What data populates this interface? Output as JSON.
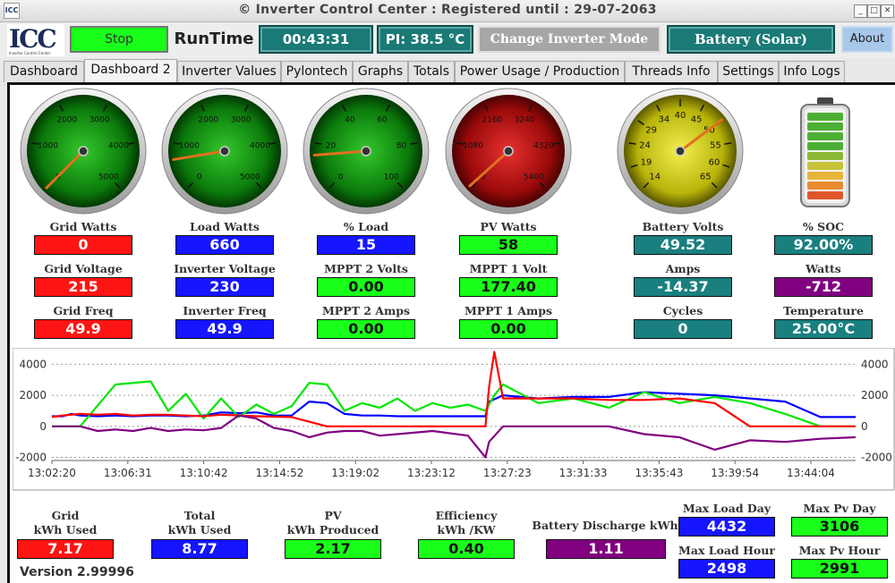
{
  "window": {
    "title": "© Inverter Control Center : Registered until : 29-07-2063",
    "app_icon": "ICC"
  },
  "toolbar": {
    "logo": "ICC",
    "logo_sub": "Inverter Control Center",
    "stop_label": "Stop",
    "runtime_label": "RunTime",
    "runtime_value": "00:43:31",
    "pi_temp": "PI: 38.5 °C",
    "change_mode_label": "Change Inverter Mode",
    "battery_mode": "Battery (Solar)",
    "about_label": "About"
  },
  "tabs": [
    "Dashboard",
    "Dashboard 2",
    "Inverter Values",
    "Pylontech",
    "Graphs",
    "Totals",
    "Power Usage / Production",
    "Threads Info",
    "Settings",
    "Info Logs"
  ],
  "active_tab": "Dashboard 2",
  "gauges": [
    {
      "name": "grid-watts-gauge",
      "ticks": [
        "0",
        "1000",
        "2000",
        "3000",
        "4000",
        "5000"
      ],
      "min": 0,
      "max": 5000,
      "value": 0
    },
    {
      "name": "load-watts-gauge",
      "ticks": [
        "0",
        "1000",
        "2000",
        "3000",
        "4000",
        "5000"
      ],
      "min": 0,
      "max": 5000,
      "value": 660
    },
    {
      "name": "percent-load-gauge",
      "ticks": [
        "0",
        "20",
        "40",
        "60",
        "80",
        "100"
      ],
      "min": 0,
      "max": 100,
      "value": 15
    },
    {
      "name": "pv-watts-gauge",
      "ticks": [
        "0",
        "1080",
        "2160",
        "3240",
        "4320",
        "5400"
      ],
      "min": 0,
      "max": 5400,
      "value": 58
    },
    {
      "name": "battery-volts-gauge",
      "ticks": [
        "14",
        "19",
        "24",
        "29",
        "34",
        "40",
        "45",
        "50",
        "55",
        "60",
        "65"
      ],
      "min": 14,
      "max": 65,
      "value": 49.52
    }
  ],
  "soc_colors": [
    "#4caf35",
    "#4caf35",
    "#4caf35",
    "#4caf35",
    "#8ab833",
    "#c8c33a",
    "#e8b43a",
    "#e88a2f",
    "#e0562a"
  ],
  "metrics": {
    "grid_watts": {
      "label": "Grid Watts",
      "value": "0"
    },
    "load_watts": {
      "label": "Load Watts",
      "value": "660"
    },
    "pct_load": {
      "label": "% Load",
      "value": "15"
    },
    "pv_watts": {
      "label": "PV Watts",
      "value": "58"
    },
    "battery_volts": {
      "label": "Battery Volts",
      "value": "49.52"
    },
    "soc": {
      "label": "% SOC",
      "value": "92.00%"
    },
    "grid_voltage": {
      "label": "Grid Voltage",
      "value": "215"
    },
    "inverter_voltage": {
      "label": "Inverter Voltage",
      "value": "230"
    },
    "mppt2_volts": {
      "label": "MPPT 2 Volts",
      "value": "0.00"
    },
    "mppt1_volt": {
      "label": "MPPT 1 Volt",
      "value": "177.40"
    },
    "amps": {
      "label": "Amps",
      "value": "-14.37"
    },
    "watts": {
      "label": "Watts",
      "value": "-712"
    },
    "grid_freq": {
      "label": "Grid Freq",
      "value": "49.9"
    },
    "inverter_freq": {
      "label": "Inverter Freq",
      "value": "49.9"
    },
    "mppt2_amps": {
      "label": "MPPT 2 Amps",
      "value": "0.00"
    },
    "mppt1_amps": {
      "label": "MPPT 1 Amps",
      "value": "0.00"
    },
    "cycles": {
      "label": "Cycles",
      "value": "0"
    },
    "temperature": {
      "label": "Temperature",
      "value": "25.00°C"
    }
  },
  "chart_data": {
    "type": "line",
    "xlabel": "",
    "ylabel": "",
    "ylim": [
      -2200,
      4600
    ],
    "yticks": [
      "4000",
      "2000",
      "0",
      "-2000"
    ],
    "x_ticks": [
      "13:02:20",
      "13:06:31",
      "13:10:42",
      "13:14:52",
      "13:19:02",
      "13:23:12",
      "13:27:23",
      "13:31:33",
      "13:35:43",
      "13:39:54",
      "13:44:04"
    ],
    "grid": "horizontal-dotted",
    "series": [
      {
        "color": "#0000ff",
        "values": [
          [
            13.04,
            650
          ],
          [
            13.1,
            650
          ],
          [
            13.15,
            800
          ],
          [
            13.2,
            700
          ],
          [
            13.3,
            650
          ],
          [
            13.4,
            700
          ],
          [
            13.5,
            650
          ],
          [
            13.6,
            700
          ],
          [
            13.7,
            700
          ],
          [
            13.8,
            650
          ],
          [
            13.9,
            700
          ],
          [
            14.0,
            900
          ],
          [
            14.1,
            850
          ],
          [
            14.2,
            900
          ],
          [
            14.3,
            700
          ],
          [
            14.4,
            700
          ],
          [
            14.5,
            1600
          ],
          [
            14.6,
            1500
          ],
          [
            14.7,
            800
          ],
          [
            14.8,
            700
          ],
          [
            14.9,
            700
          ],
          [
            15.0,
            650
          ],
          [
            15.5,
            650
          ],
          [
            15.52,
            1600
          ],
          [
            15.6,
            2000
          ],
          [
            15.8,
            1800
          ],
          [
            16.0,
            1900
          ],
          [
            16.2,
            1900
          ],
          [
            16.4,
            2200
          ],
          [
            16.6,
            2100
          ],
          [
            16.8,
            2000
          ],
          [
            17.0,
            1800
          ],
          [
            17.2,
            1600
          ],
          [
            17.4,
            600
          ],
          [
            17.6,
            600
          ]
        ]
      },
      {
        "color": "#00e600",
        "values": [
          [
            13.04,
            0
          ],
          [
            13.2,
            0
          ],
          [
            13.4,
            2700
          ],
          [
            13.6,
            2900
          ],
          [
            13.7,
            1000
          ],
          [
            13.8,
            2100
          ],
          [
            13.9,
            500
          ],
          [
            14.0,
            1800
          ],
          [
            14.1,
            600
          ],
          [
            14.2,
            1400
          ],
          [
            14.3,
            800
          ],
          [
            14.4,
            1300
          ],
          [
            14.5,
            2800
          ],
          [
            14.6,
            2700
          ],
          [
            14.7,
            1000
          ],
          [
            14.8,
            1500
          ],
          [
            14.9,
            1200
          ],
          [
            15.0,
            1800
          ],
          [
            15.1,
            1000
          ],
          [
            15.2,
            1500
          ],
          [
            15.3,
            1200
          ],
          [
            15.4,
            1400
          ],
          [
            15.5,
            1000
          ],
          [
            15.55,
            2000
          ],
          [
            15.6,
            2700
          ],
          [
            15.8,
            1500
          ],
          [
            16.0,
            1800
          ],
          [
            16.2,
            1200
          ],
          [
            16.4,
            2200
          ],
          [
            16.6,
            1500
          ],
          [
            16.8,
            1900
          ],
          [
            17.0,
            1500
          ],
          [
            17.2,
            800
          ],
          [
            17.4,
            0
          ],
          [
            17.6,
            0
          ]
        ]
      },
      {
        "color": "#ff0000",
        "values": [
          [
            13.04,
            600
          ],
          [
            13.1,
            700
          ],
          [
            13.2,
            800
          ],
          [
            13.3,
            750
          ],
          [
            13.4,
            800
          ],
          [
            13.5,
            700
          ],
          [
            13.6,
            750
          ],
          [
            13.7,
            750
          ],
          [
            13.8,
            700
          ],
          [
            13.9,
            650
          ],
          [
            14.0,
            750
          ],
          [
            14.2,
            650
          ],
          [
            14.4,
            600
          ],
          [
            14.6,
            0
          ],
          [
            14.8,
            0
          ],
          [
            15.0,
            0
          ],
          [
            15.3,
            0
          ],
          [
            15.5,
            0
          ],
          [
            15.52,
            2500
          ],
          [
            15.55,
            4800
          ],
          [
            15.6,
            1800
          ],
          [
            15.8,
            1800
          ],
          [
            16.0,
            1800
          ],
          [
            16.2,
            1700
          ],
          [
            16.4,
            1700
          ],
          [
            16.6,
            1800
          ],
          [
            16.8,
            1500
          ],
          [
            17.0,
            0
          ],
          [
            17.6,
            0
          ]
        ]
      },
      {
        "color": "#800080",
        "values": [
          [
            13.04,
            0
          ],
          [
            13.2,
            0
          ],
          [
            13.3,
            -300
          ],
          [
            13.4,
            -200
          ],
          [
            13.5,
            -300
          ],
          [
            13.6,
            -100
          ],
          [
            13.7,
            -300
          ],
          [
            13.8,
            -200
          ],
          [
            13.9,
            -250
          ],
          [
            14.0,
            -100
          ],
          [
            14.1,
            700
          ],
          [
            14.2,
            500
          ],
          [
            14.3,
            -100
          ],
          [
            14.4,
            -300
          ],
          [
            14.5,
            -700
          ],
          [
            14.6,
            -400
          ],
          [
            14.7,
            -300
          ],
          [
            14.8,
            -300
          ],
          [
            14.9,
            -600
          ],
          [
            15.0,
            -500
          ],
          [
            15.2,
            -300
          ],
          [
            15.4,
            -600
          ],
          [
            15.5,
            -2000
          ],
          [
            15.52,
            -1000
          ],
          [
            15.6,
            0
          ],
          [
            15.8,
            0
          ],
          [
            16.0,
            0
          ],
          [
            16.2,
            0
          ],
          [
            16.4,
            -500
          ],
          [
            16.6,
            -700
          ],
          [
            16.8,
            -1500
          ],
          [
            17.0,
            -900
          ],
          [
            17.2,
            -1000
          ],
          [
            17.4,
            -800
          ],
          [
            17.6,
            -700
          ]
        ]
      }
    ]
  },
  "totals": {
    "grid_kwh": {
      "label_line1": "Grid",
      "label_line2": "kWh Used",
      "value": "7.17"
    },
    "total_kwh": {
      "label_line1": "Total",
      "label_line2": "kWh Used",
      "value": "8.77"
    },
    "pv_kwh": {
      "label_line1": "PV",
      "label_line2": "kWh Produced",
      "value": "2.17"
    },
    "efficiency": {
      "label_line1": "Efficiency",
      "label_line2": "kWh /KW",
      "value": "0.40"
    },
    "battery_discharge": {
      "label": "Battery Discharge kWh",
      "value": "1.11"
    },
    "max_load_day": {
      "label": "Max Load Day",
      "value": "4432"
    },
    "max_pv_day": {
      "label": "Max Pv Day",
      "value": "3106"
    },
    "max_load_hour": {
      "label": "Max Load Hour",
      "value": "2498"
    },
    "max_pv_hour": {
      "label": "Max Pv Hour",
      "value": "2991"
    }
  },
  "version": "Version 2.99996"
}
